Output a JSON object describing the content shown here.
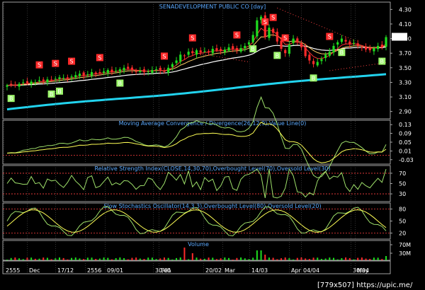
{
  "title": "SENADEVELOPMENT PUBLIC CO [day]",
  "watermark": "[779x507] https://upic.me/",
  "x_labels": [
    "2555",
    "Dec",
    "17/12",
    "2556",
    "09/01",
    "30/01",
    "Feb",
    "20/02",
    "Mar",
    "14/03",
    "Apr",
    "04/04",
    "30/04",
    "May"
  ],
  "colors": {
    "bg": "#000000",
    "bull": "#1fdc1f",
    "bear": "#ff2a2a",
    "ema_fast": "#ffffff",
    "ema_slow": "#ffcc66",
    "ma_red": "#ff3333",
    "long_ma": "#22d3ee",
    "signal_line": "#ffff55",
    "oscillator": "#9ee06a",
    "dotted_ref": "#ff4040"
  },
  "chart_data": [
    {
      "type": "candlestick",
      "title": "SENADEVELOPMENT PUBLIC CO [day]",
      "y_ticks": [
        "4.30",
        "4.10",
        "3.90",
        "3.70",
        "3.50",
        "3.30",
        "3.10",
        "2.90"
      ],
      "ylim": [
        2.8,
        4.4
      ],
      "last_price": "3.92",
      "close_values": [
        3.26,
        3.27,
        3.26,
        3.28,
        3.3,
        3.29,
        3.31,
        3.3,
        3.33,
        3.32,
        3.34,
        3.33,
        3.35,
        3.37,
        3.36,
        3.35,
        3.38,
        3.4,
        3.42,
        3.39,
        3.41,
        3.44,
        3.42,
        3.43,
        3.45,
        3.47,
        3.44,
        3.46,
        3.48,
        3.5,
        3.49,
        3.47,
        3.45,
        3.46,
        3.44,
        3.45,
        3.47,
        3.48,
        3.46,
        3.45,
        3.5,
        3.55,
        3.6,
        3.68,
        3.66,
        3.72,
        3.7,
        3.74,
        3.71,
        3.73,
        3.72,
        3.76,
        3.74,
        3.73,
        3.75,
        3.78,
        3.76,
        3.74,
        3.77,
        3.8,
        3.85,
        3.95,
        4.15,
        4.2,
        3.92,
        4.05,
        3.98,
        3.86,
        3.76,
        3.7,
        3.82,
        3.9,
        3.86,
        3.78,
        3.66,
        3.6,
        3.55,
        3.58,
        3.62,
        3.68,
        3.72,
        3.8,
        3.85,
        3.9,
        3.86,
        3.82,
        3.84,
        3.8,
        3.78,
        3.75,
        3.74,
        3.77,
        3.8,
        3.78,
        3.92
      ],
      "signals": {
        "sell": [
          8,
          12,
          16,
          23,
          39,
          46,
          57,
          64,
          66,
          69,
          80
        ],
        "buy": [
          1,
          11,
          13,
          28,
          61,
          67,
          76,
          83,
          93
        ]
      }
    },
    {
      "type": "line",
      "title": "Moving Average Convergence / Divergence(26,12,9),Value Line(0)",
      "y_ticks": [
        "0.13",
        "0.09",
        "0.05",
        "0.01",
        "-0.03"
      ],
      "ylim": [
        -0.05,
        0.15
      ],
      "reference": -0.01
    },
    {
      "type": "line",
      "title": "Relative Strength Index(CLOSE,14,30,70),Overbought Level(70),Oversold Level(30)",
      "y_ticks": [
        "70",
        "50",
        "30"
      ],
      "ylim": [
        15,
        85
      ],
      "overbought": 70,
      "oversold": 30
    },
    {
      "type": "line",
      "title": "Slow Stochastics Oscillator(14,3,3),Overbought Level(80),Oversold Level(20)",
      "y_ticks": [
        "80",
        "50",
        "20"
      ],
      "ylim": [
        5,
        95
      ],
      "overbought": 80,
      "oversold": 20
    },
    {
      "type": "bar",
      "title": "Volume",
      "y_ticks": [
        "70M",
        "30M"
      ]
    }
  ]
}
